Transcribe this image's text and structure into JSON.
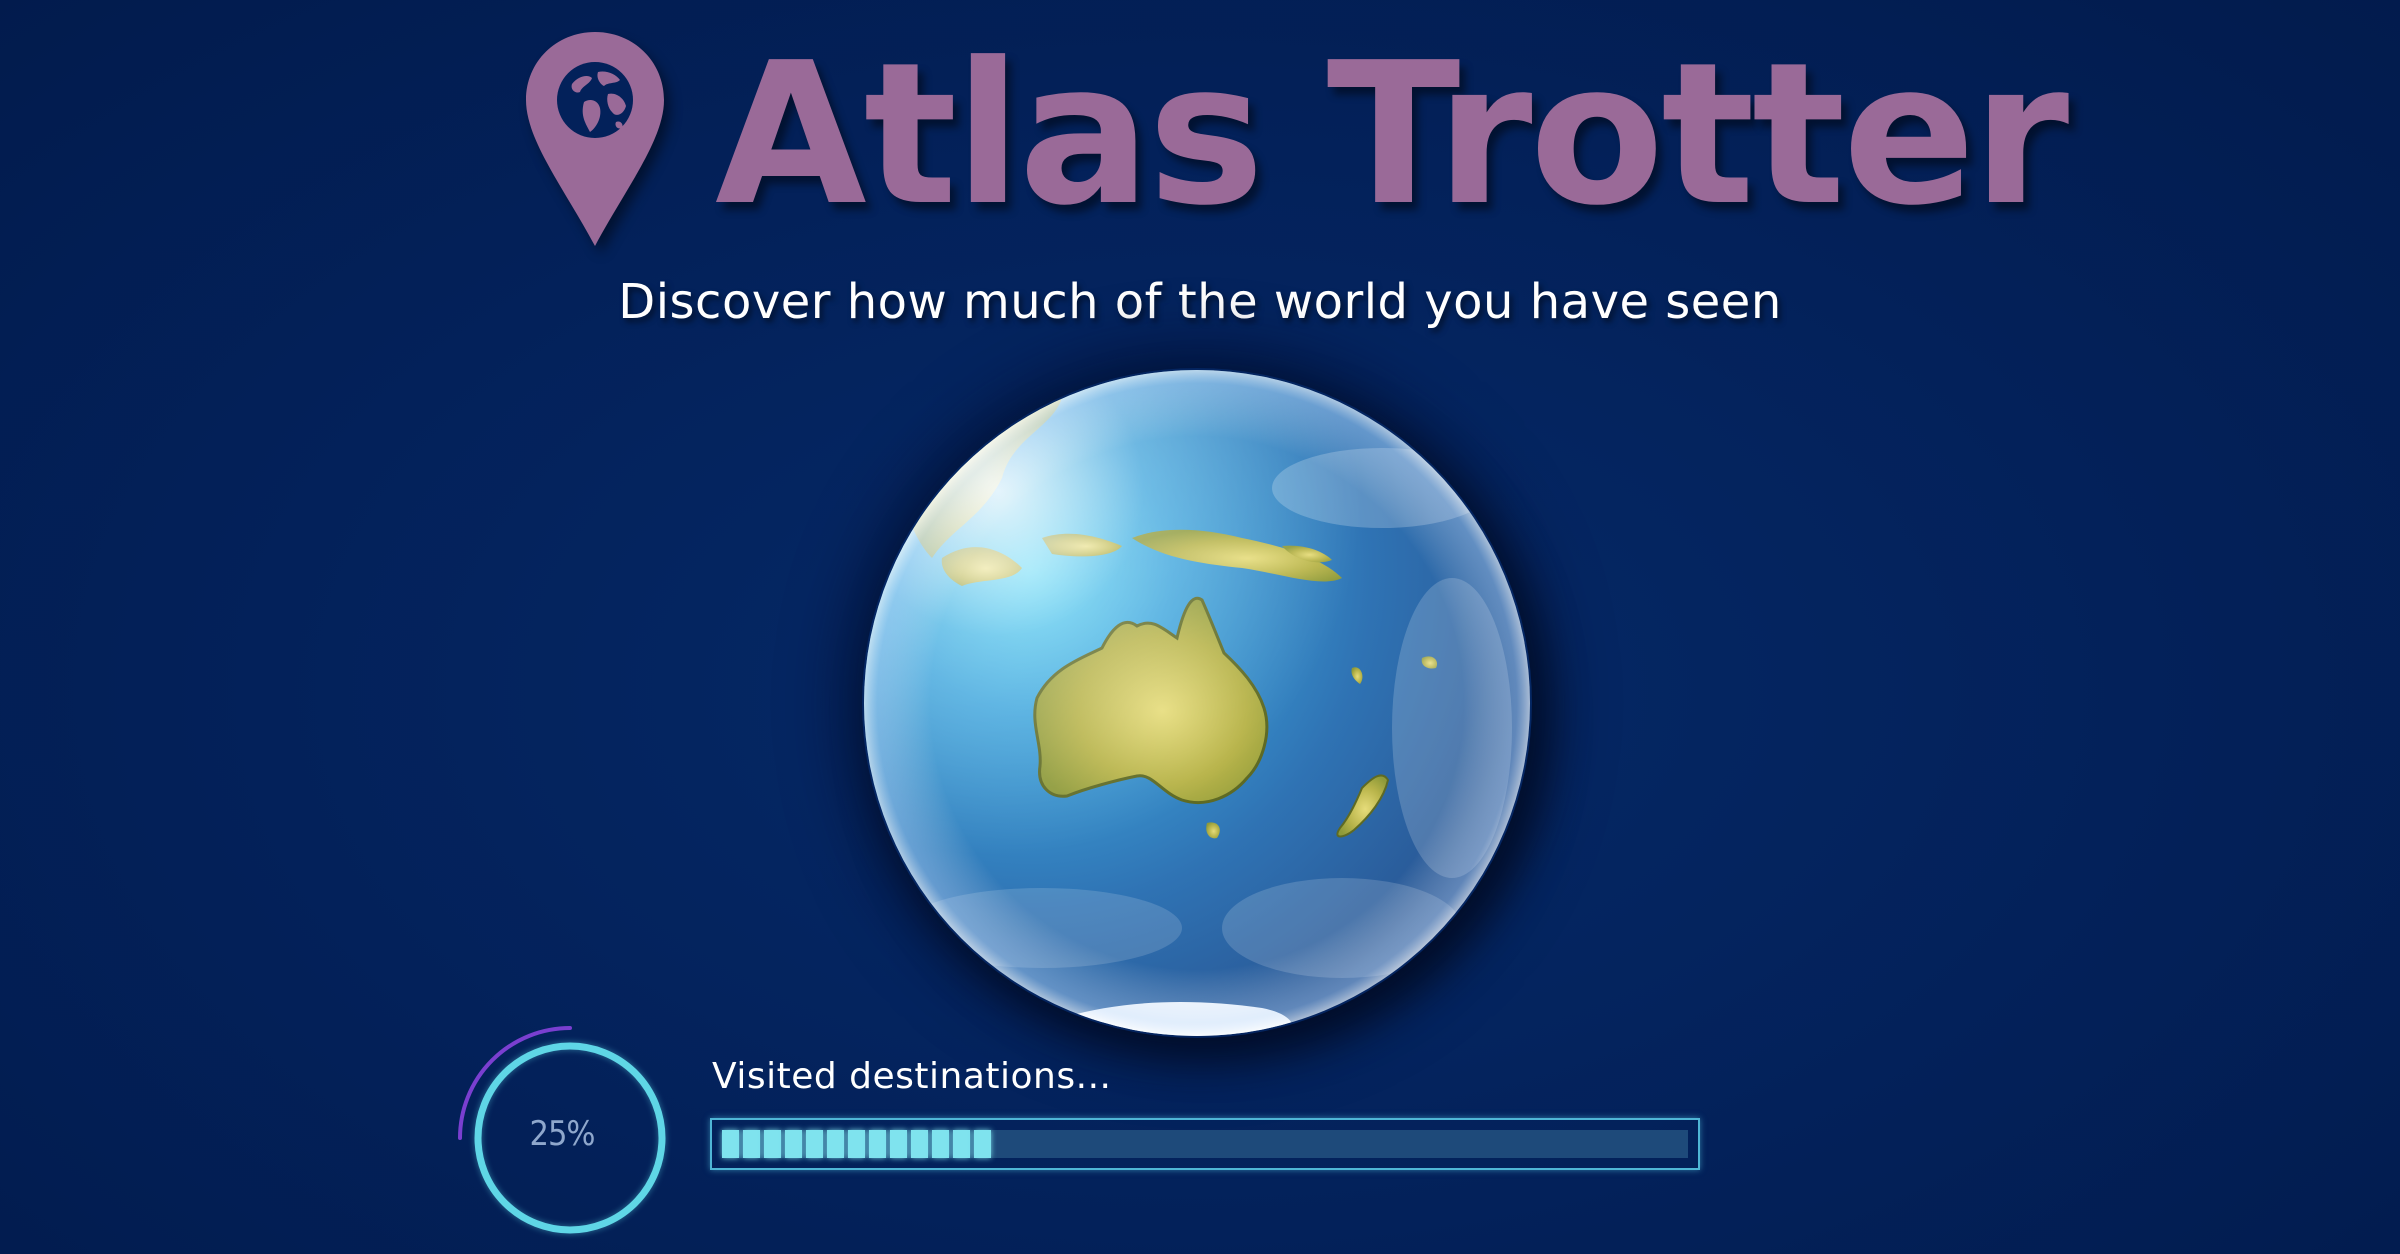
{
  "app": {
    "title": "Atlas Trotter",
    "subtitle": "Discover how much of the world you have seen"
  },
  "logo": {
    "icon": "map-pin-globe-icon",
    "color": "#9a6a98"
  },
  "globe": {
    "icon": "earth-globe-australia"
  },
  "progress": {
    "ring_text": "25%",
    "label": "Visited destinations...",
    "value_percent": 25,
    "fill_fraction": 0.28,
    "segments_filled": 13,
    "accent_color": "#7fe3ee",
    "ring_color": "#5fd6e6",
    "arc_color": "#7a3fd0"
  },
  "colors": {
    "background": "#03215a",
    "text": "#ffffff"
  }
}
